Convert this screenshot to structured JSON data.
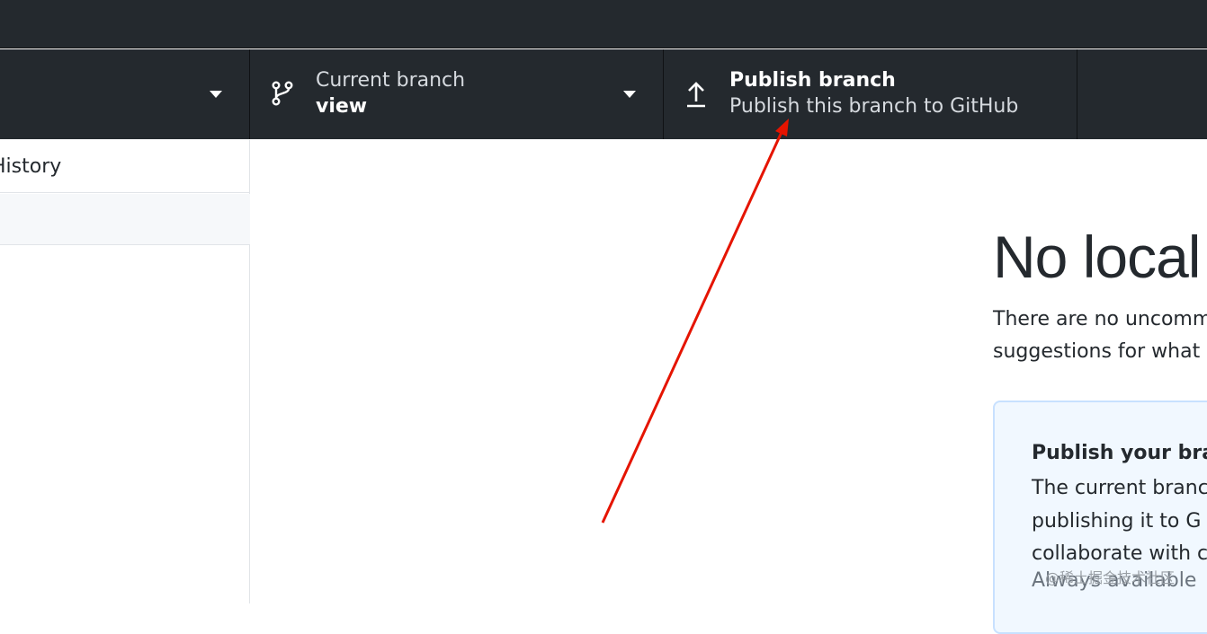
{
  "toolbar": {
    "branch": {
      "label": "Current branch",
      "value": "view",
      "icon": "git-branch-icon"
    },
    "publish": {
      "label": "Publish branch",
      "description": "Publish this branch to GitHub",
      "icon": "upload-arrow-icon"
    }
  },
  "sidebar": {
    "tab_history": "History"
  },
  "main": {
    "heading": "No local",
    "description_line1": "There are no uncomm",
    "description_line2": "suggestions for what",
    "card": {
      "title": "Publish your bra",
      "body_line1": "The current branc",
      "body_line2": "publishing it to G",
      "body_line3": "collaborate with c",
      "footer": "Always available"
    }
  },
  "watermark": "@稀土掘金技术社区",
  "colors": {
    "toolbar_bg": "#24292e",
    "card_bg": "#f1f8ff",
    "card_border": "#c8e1ff",
    "annotation_arrow": "#e51400"
  }
}
